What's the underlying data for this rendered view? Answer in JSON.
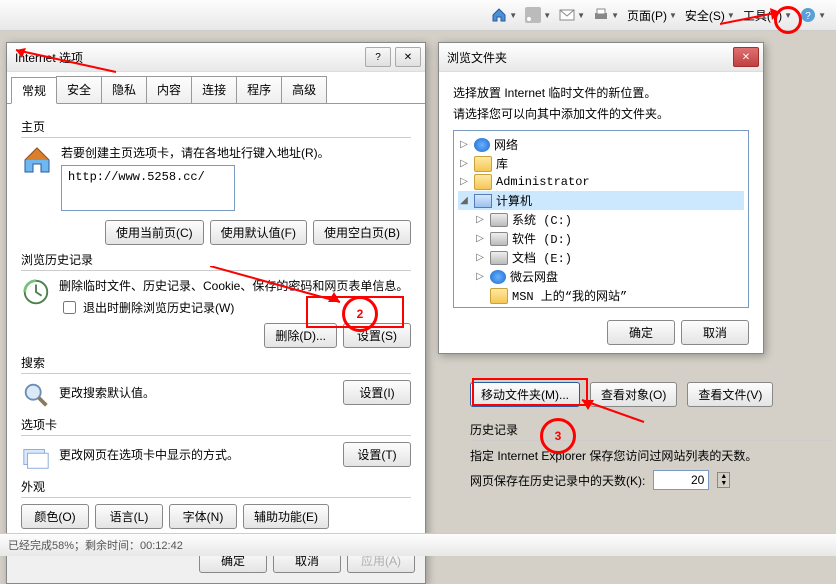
{
  "toolbar": {
    "page": "页面(P)",
    "safety": "安全(S)",
    "tools": "工具(T)"
  },
  "dlg1": {
    "title": "Internet 选项",
    "tabs": [
      "常规",
      "安全",
      "隐私",
      "内容",
      "连接",
      "程序",
      "高级"
    ],
    "home": {
      "label": "主页",
      "desc": "若要创建主页选项卡，请在各地址行键入地址(R)。",
      "url": "http://www.5258.cc/"
    },
    "home_btns": {
      "cur": "使用当前页(C)",
      "def": "使用默认值(F)",
      "blank": "使用空白页(B)"
    },
    "hist": {
      "label": "浏览历史记录",
      "desc": "删除临时文件、历史记录、Cookie、保存的密码和网页表单信息。",
      "chk": "退出时删除浏览历史记录(W)",
      "del": "删除(D)...",
      "set": "设置(S)"
    },
    "search": {
      "label": "搜索",
      "desc": "更改搜索默认值。",
      "set": "设置(I)"
    },
    "tabsg": {
      "label": "选项卡",
      "desc": "更改网页在选项卡中显示的方式。",
      "set": "设置(T)"
    },
    "look": {
      "label": "外观",
      "color": "颜色(O)",
      "lang": "语言(L)",
      "font": "字体(N)",
      "acc": "辅助功能(E)"
    },
    "footer": {
      "ok": "确定",
      "cancel": "取消",
      "apply": "应用(A)"
    }
  },
  "dlg2": {
    "title": "浏览文件夹",
    "line1": "选择放置 Internet 临时文件的新位置。",
    "line2": "请选择您可以向其中添加文件的文件夹。",
    "tree": [
      {
        "lvl": 0,
        "exp": "▷",
        "ico": "net",
        "label": "网络"
      },
      {
        "lvl": 0,
        "exp": "▷",
        "ico": "folder",
        "label": "库"
      },
      {
        "lvl": 0,
        "exp": "▷",
        "ico": "folder",
        "label": "Administrator"
      },
      {
        "lvl": 0,
        "exp": "◢",
        "ico": "pc",
        "label": "计算机",
        "sel": true
      },
      {
        "lvl": 1,
        "exp": "▷",
        "ico": "drive",
        "label": "系统 (C:)"
      },
      {
        "lvl": 1,
        "exp": "▷",
        "ico": "drive",
        "label": "软件 (D:)"
      },
      {
        "lvl": 1,
        "exp": "▷",
        "ico": "drive",
        "label": "文档 (E:)"
      },
      {
        "lvl": 1,
        "exp": "▷",
        "ico": "net",
        "label": "微云网盘"
      },
      {
        "lvl": 1,
        "exp": "",
        "ico": "folder",
        "label": "MSN 上的“我的网站”"
      }
    ],
    "ok": "确定",
    "cancel": "取消"
  },
  "lower": {
    "move": "移动文件夹(M)...",
    "viewobj": "查看对象(O)",
    "viewfile": "查看文件(V)",
    "hist_label": "历史记录",
    "hist_desc": "指定 Internet Explorer 保存您访问过网站列表的天数。",
    "days_label": "网页保存在历史记录中的天数(K):",
    "days_val": "20"
  },
  "status": "已经完成58%；剩余时间：00:12:42",
  "annot": {
    "n2": "2",
    "n3": "3"
  }
}
